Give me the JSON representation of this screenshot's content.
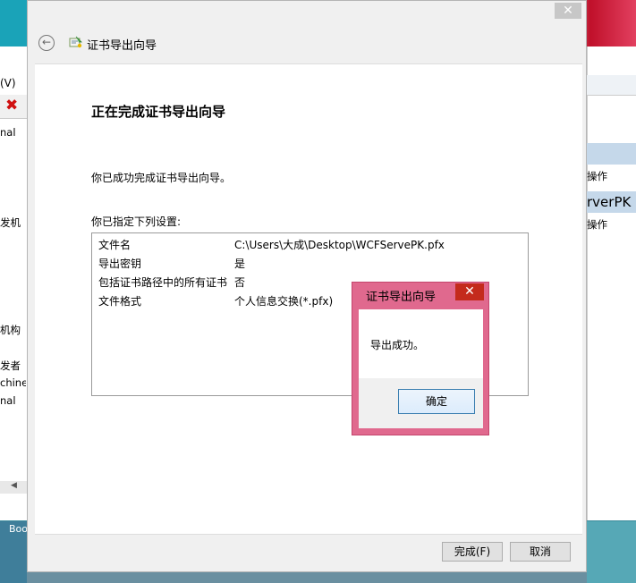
{
  "background": {
    "left_menu_fragment": "(V)",
    "left_items": [
      "nal",
      "发机",
      "机构",
      "发者",
      "chine",
      "nal"
    ],
    "left_bottom_fragment": "Boo",
    "right_items": [
      "操作",
      "操作"
    ],
    "right_fragment": "rverPK"
  },
  "wizard": {
    "title": "证书导出向导",
    "heading": "正在完成证书导出向导",
    "success_text": "你已成功完成证书导出向导。",
    "settings_label": "你已指定下列设置:",
    "settings": [
      {
        "key": "文件名",
        "value": "C:\\Users\\大成\\Desktop\\WCFServePK.pfx"
      },
      {
        "key": "导出密钥",
        "value": "是"
      },
      {
        "key": "包括证书路径中的所有证书",
        "value": "否"
      },
      {
        "key": "文件格式",
        "value": "个人信息交换(*.pfx)"
      }
    ],
    "finish_label": "完成(F)",
    "cancel_label": "取消"
  },
  "message_box": {
    "title": "证书导出向导",
    "text": "导出成功。",
    "ok_label": "确定"
  },
  "colors": {
    "message_box_frame": "#e0698e",
    "close_red": "#c42b1c"
  }
}
